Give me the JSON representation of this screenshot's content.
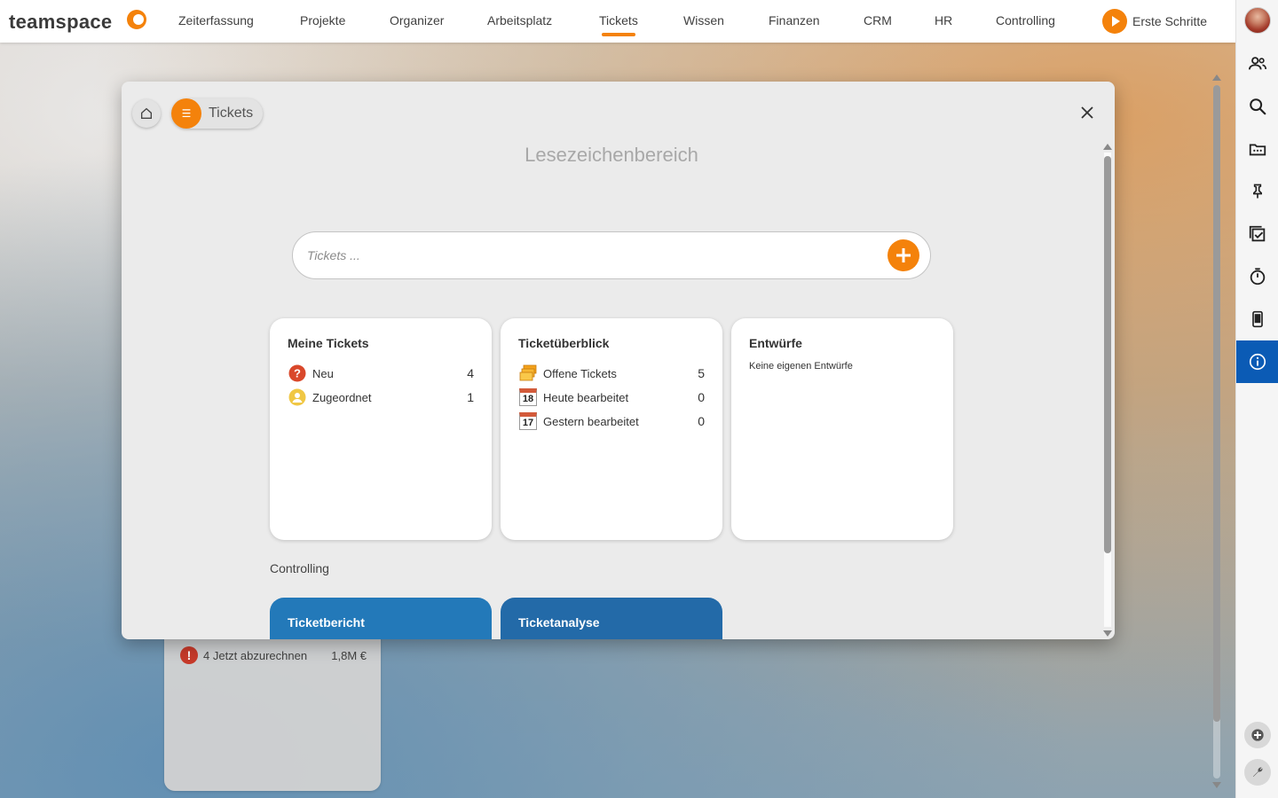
{
  "app": {
    "logo_text": "teamspace"
  },
  "nav": {
    "items": [
      {
        "label": "Zeiterfassung"
      },
      {
        "label": "Projekte"
      },
      {
        "label": "Organizer"
      },
      {
        "label": "Arbeitsplatz"
      },
      {
        "label": "Tickets"
      },
      {
        "label": "Wissen"
      },
      {
        "label": "Finanzen"
      },
      {
        "label": "CRM"
      },
      {
        "label": "HR"
      },
      {
        "label": "Controlling"
      }
    ],
    "active": "Tickets",
    "erste_schritte": "Erste Schritte"
  },
  "modal": {
    "breadcrumb_label": "Tickets",
    "title": "Lesezeichenbereich",
    "search_placeholder": "Tickets ...",
    "cards": {
      "meine_tickets": {
        "title": "Meine Tickets",
        "rows": [
          {
            "label": "Neu",
            "value": "4",
            "icon": "question-icon"
          },
          {
            "label": "Zugeordnet",
            "value": "1",
            "icon": "user-icon"
          }
        ]
      },
      "ticketueberblick": {
        "title": "Ticketüberblick",
        "rows": [
          {
            "label": "Offene Tickets",
            "value": "5",
            "icon": "tickets-stack-icon"
          },
          {
            "label": "Heute bearbeitet",
            "value": "0",
            "icon": "calendar-icon",
            "day": "18"
          },
          {
            "label": "Gestern bearbeitet",
            "value": "0",
            "icon": "calendar-icon",
            "day": "17"
          }
        ]
      },
      "entwuerfe": {
        "title": "Entwürfe",
        "empty_text": "Keine eigenen Entwürfe"
      }
    },
    "section_label": "Controlling",
    "controlling_cards": [
      {
        "title": "Ticketbericht",
        "color": "#2379b9"
      },
      {
        "title": "Ticketanalyse",
        "color": "#236aa8"
      }
    ]
  },
  "background_card": {
    "row_label": "4 Jetzt abzurechnen",
    "row_value": "1,8M €"
  },
  "colors": {
    "accent": "#f4820b",
    "active_sidebar": "#0b5bb5"
  }
}
